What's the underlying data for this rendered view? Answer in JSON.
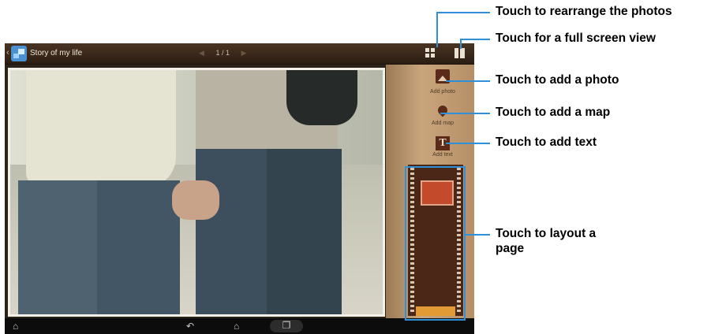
{
  "screen": {
    "title": "Story of my life",
    "pager": {
      "prev": "◀",
      "current": "1 / 1",
      "next": "▶"
    },
    "tools": [
      {
        "label": "Add photo",
        "icon": "add-photo-icon"
      },
      {
        "label": "Add map",
        "icon": "map-pin-icon"
      },
      {
        "label": "Add text",
        "icon": "text-T-icon"
      }
    ],
    "nav": {
      "home_bar": "⌂",
      "back": "↶",
      "home": "⌂",
      "recent": "❐"
    }
  },
  "callouts": [
    "Touch to rearrange the photos",
    "Touch for a full screen view",
    "Touch to add a photo",
    "Touch to add a map",
    "Touch to add text",
    "Touch to layout a",
    "page"
  ],
  "colors": {
    "callout_line": "#2f8fd8",
    "panel": "#c9a57c",
    "topbar": "#3b2a1b"
  }
}
